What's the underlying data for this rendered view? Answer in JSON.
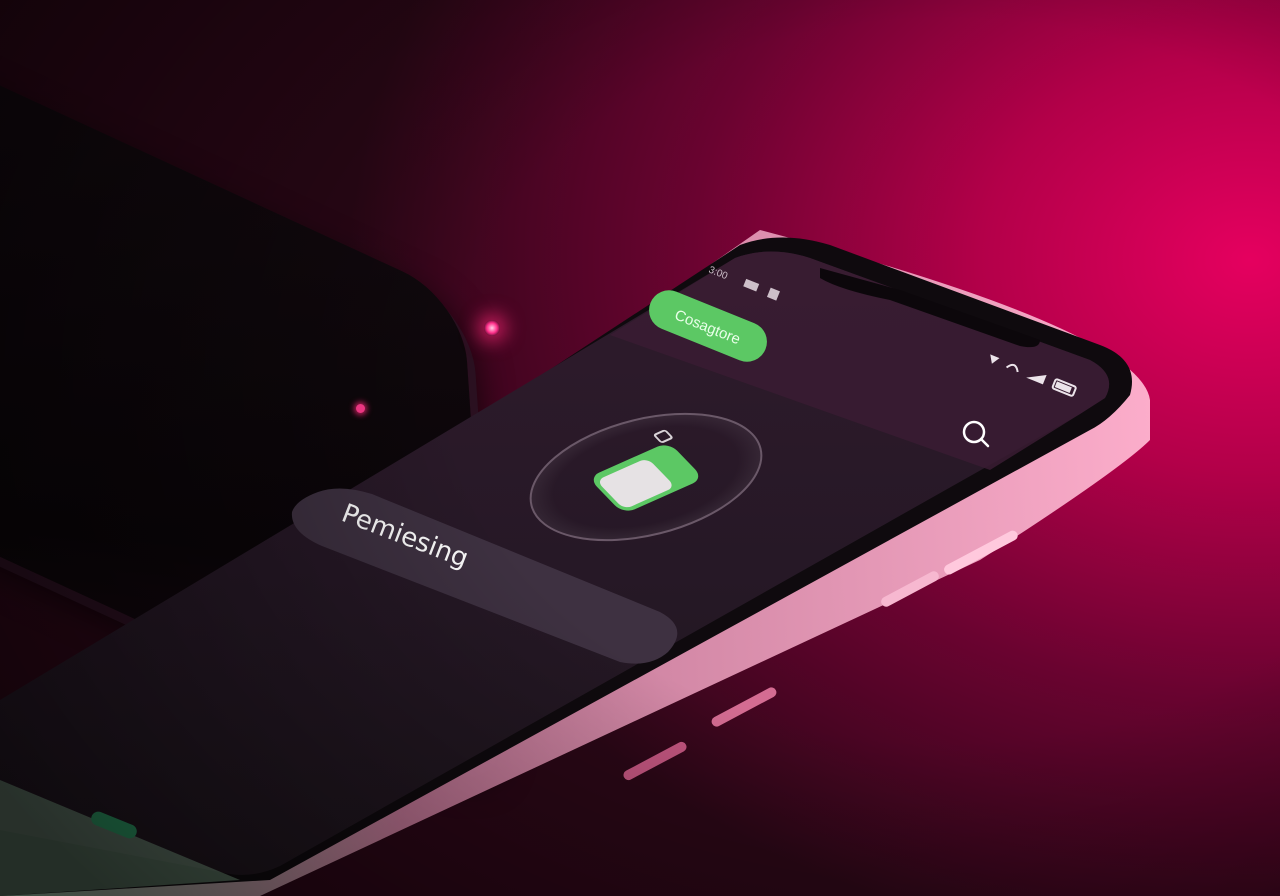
{
  "scene": {
    "background_accent": "#e5005f",
    "background_dark": "#2a0716"
  },
  "phone": {
    "status_bar": {
      "time": "3:00",
      "icons": [
        "signal-icon",
        "wifi-icon",
        "cellular-icon",
        "battery-icon"
      ]
    },
    "top_badge": {
      "label": "Cosagtore",
      "color": "#5cc864"
    },
    "search_icon": "search-icon",
    "battery_graphic": {
      "icon": "battery-charging-icon",
      "fill_color": "#5cc864"
    },
    "status_card": {
      "text": "Pemiesing"
    }
  }
}
